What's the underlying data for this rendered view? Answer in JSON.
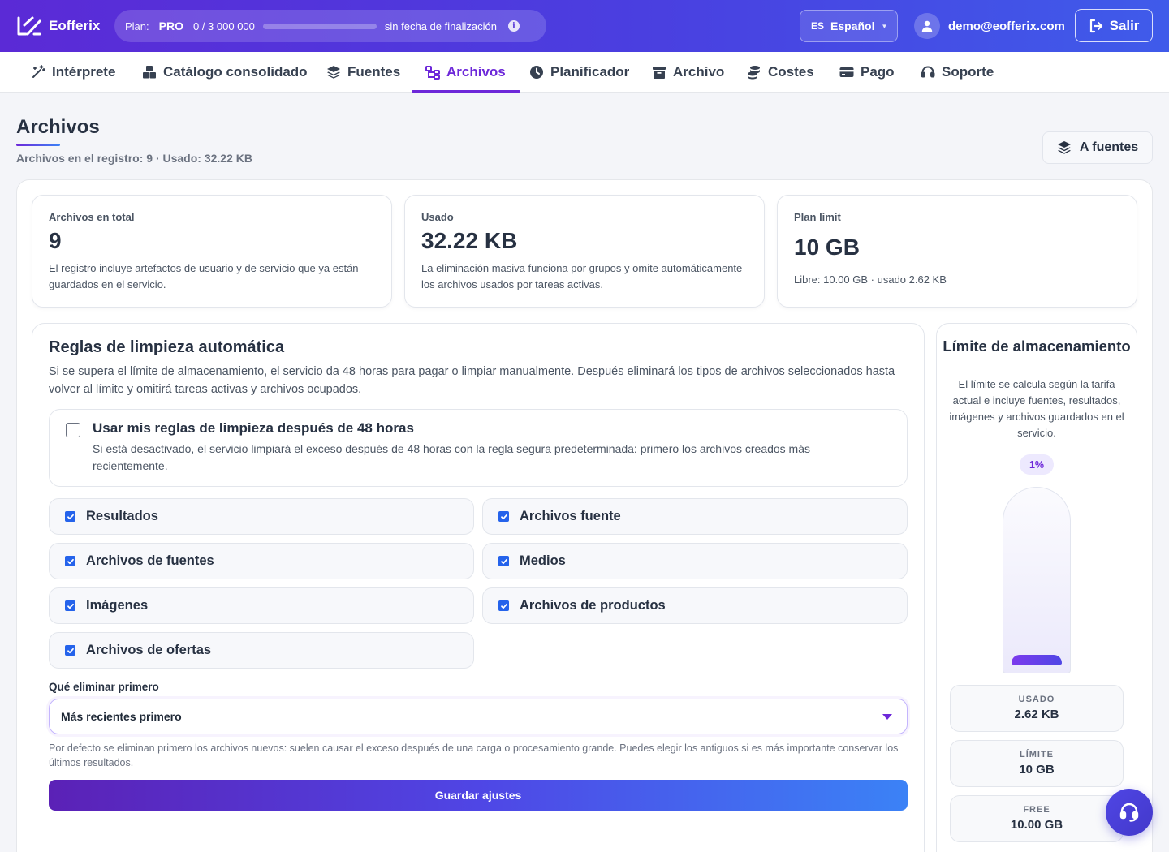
{
  "app": {
    "name": "Eofferix"
  },
  "plan": {
    "label": "Plan:",
    "tier": "PRO",
    "usage": "0 / 3 000 000",
    "usage_fraction": 0,
    "deadline": "sin fecha de finalización",
    "info_icon": "info-icon"
  },
  "language": {
    "code": "ES",
    "name": "Español"
  },
  "user": {
    "email": "demo@eofferix.com"
  },
  "logout_label": "Salir",
  "nav": {
    "tabs": [
      {
        "label": "Intérprete",
        "icon": "magic-wand-icon"
      },
      {
        "label": "Catálogo consolidado",
        "icon": "boxes-icon"
      },
      {
        "label": "Fuentes",
        "icon": "layers-icon"
      },
      {
        "label": "Archivos",
        "icon": "folder-tree-icon",
        "active": true
      },
      {
        "label": "Planificador",
        "icon": "clock-icon"
      },
      {
        "label": "Archivo",
        "icon": "archive-icon"
      },
      {
        "label": "Costes",
        "icon": "coins-icon"
      },
      {
        "label": "Pago",
        "icon": "credit-card-icon"
      },
      {
        "label": "Soporte",
        "icon": "headset-icon"
      }
    ]
  },
  "page": {
    "title": "Archivos",
    "subtitle": "Archivos en el registro: 9 · Usado: 32.22 KB",
    "to_sources_label": "A fuentes"
  },
  "stats": {
    "total": {
      "label": "Archivos en total",
      "value": "9",
      "desc": "El registro incluye artefactos de usuario y de servicio que ya están guardados en el servicio."
    },
    "used": {
      "label": "Usado",
      "value": "32.22 KB",
      "desc": "La eliminación masiva funciona por grupos y omite automáticamente los archivos usados por tareas activas."
    },
    "limit": {
      "label": "Plan limit",
      "value": "10 GB",
      "desc": "Libre: 10.00 GB · usado 2.62 KB"
    }
  },
  "rules": {
    "title": "Reglas de limpieza automática",
    "desc": "Si se supera el límite de almacenamiento, el servicio da 48 horas para pagar o limpiar manualmente. Después eliminará los tipos de archivos seleccionados hasta volver al límite y omitirá tareas activas y archivos ocupados.",
    "custom": {
      "checked": false,
      "title": "Usar mis reglas de limpieza después de 48 horas",
      "desc": "Si está desactivado, el servicio limpiará el exceso después de 48 horas con la regla segura predeterminada: primero los archivos creados más recientemente."
    },
    "options": [
      {
        "label": "Resultados",
        "checked": true
      },
      {
        "label": "Archivos fuente",
        "checked": true
      },
      {
        "label": "Archivos de fuentes",
        "checked": true
      },
      {
        "label": "Medios",
        "checked": true
      },
      {
        "label": "Imágenes",
        "checked": true
      },
      {
        "label": "Archivos de productos",
        "checked": true
      },
      {
        "label": "Archivos de ofertas",
        "checked": true
      }
    ],
    "order_label": "Qué eliminar primero",
    "order_value": "Más recientes primero",
    "order_hint": "Por defecto se eliminan primero los archivos nuevos: suelen causar el exceso después de una carga o procesamiento grande. Puedes elegir los antiguos si es más importante conservar los últimos resultados.",
    "save_label": "Guardar ajustes"
  },
  "storage": {
    "title": "Límite de almacenamiento",
    "desc": "El límite se calcula según la tarifa actual e incluye fuentes, resultados, imágenes y archivos guardados en el servicio.",
    "percent_label": "1%",
    "fill_fraction": 0.01,
    "used_key": "USADO",
    "used_value": "2.62 KB",
    "limit_key": "LÍMITE",
    "limit_value": "10 GB",
    "free_key": "FREE",
    "free_value": "10.00 GB"
  },
  "colors": {
    "brand_start": "#5b2ad6",
    "brand_end": "#3f5bea",
    "accent": "#6d28d9",
    "checkbox": "#2563eb"
  }
}
